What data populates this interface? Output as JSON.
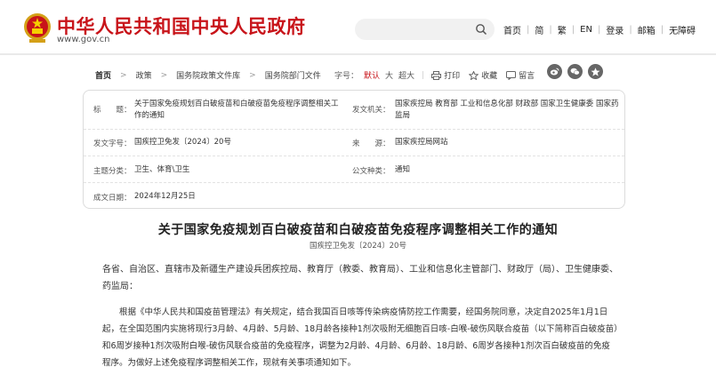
{
  "header": {
    "site_title": "中华人民共和国中央人民政府",
    "site_url": "www.gov.cn",
    "links": [
      "首页",
      "简",
      "繁",
      "EN",
      "登录",
      "邮箱",
      "无障碍"
    ],
    "colors": {
      "brand": "#c8141a"
    }
  },
  "toolbar": {
    "breadcrumbs": [
      "首页",
      "政策",
      "国务院政策文件库",
      "国务院部门文件"
    ],
    "font_size_label": "字号：",
    "font_sizes": [
      "默认",
      "大",
      "超大"
    ],
    "font_size_selected": "默认",
    "print_label": "打印",
    "favorite_label": "收藏",
    "message_label": "留言",
    "share_icons": [
      "weibo-icon",
      "wechat-icon",
      "qzone-icon"
    ]
  },
  "info": {
    "title_key": "标　　题：",
    "title_val": "关于国家免疫规划百白破疫苗和白破疫苗免疫程序调整相关工作的通知",
    "issuer_key": "发文机关：",
    "issuer_val": "国家疾控局 教育部 工业和信息化部 财政部 国家卫生健康委 国家药监局",
    "docno_key": "发文字号：",
    "docno_val": "国疾控卫免发〔2024〕20号",
    "source_key": "来　　源：",
    "source_val": "国家疾控局网站",
    "topic_key": "主题分类：",
    "topic_val": "卫生、体育\\卫生",
    "type_key": "公文种类：",
    "type_val": "通知",
    "date_key": "成文日期：",
    "date_val": "2024年12月25日"
  },
  "article": {
    "title": "关于国家免疫规划百白破疫苗和白破疫苗免疫程序调整相关工作的通知",
    "doc_no": "国疾控卫免发〔2024〕20号",
    "recipients": "各省、自治区、直辖市及新疆生产建设兵团疾控局、教育厅（教委、教育局）、工业和信息化主管部门、财政厅（局）、卫生健康委、药监局：",
    "paragraph": "根据《中华人民共和国疫苗管理法》有关规定，结合我国百日咳等传染病疫情防控工作需要，经国务院同意，决定自2025年1月1日起，在全国范围内实施将现行3月龄、4月龄、5月龄、18月龄各接种1剂次吸附无细胞百日咳-白喉-破伤风联合疫苗（以下简称百白破疫苗）和6周岁接种1剂次吸附白喉-破伤风联合疫苗的免疫程序，调整为2月龄、4月龄、6月龄、18月龄、6周岁各接种1剂次百白破疫苗的免疫程序。为做好上述免疫程序调整相关工作，现就有关事项通知如下。"
  }
}
